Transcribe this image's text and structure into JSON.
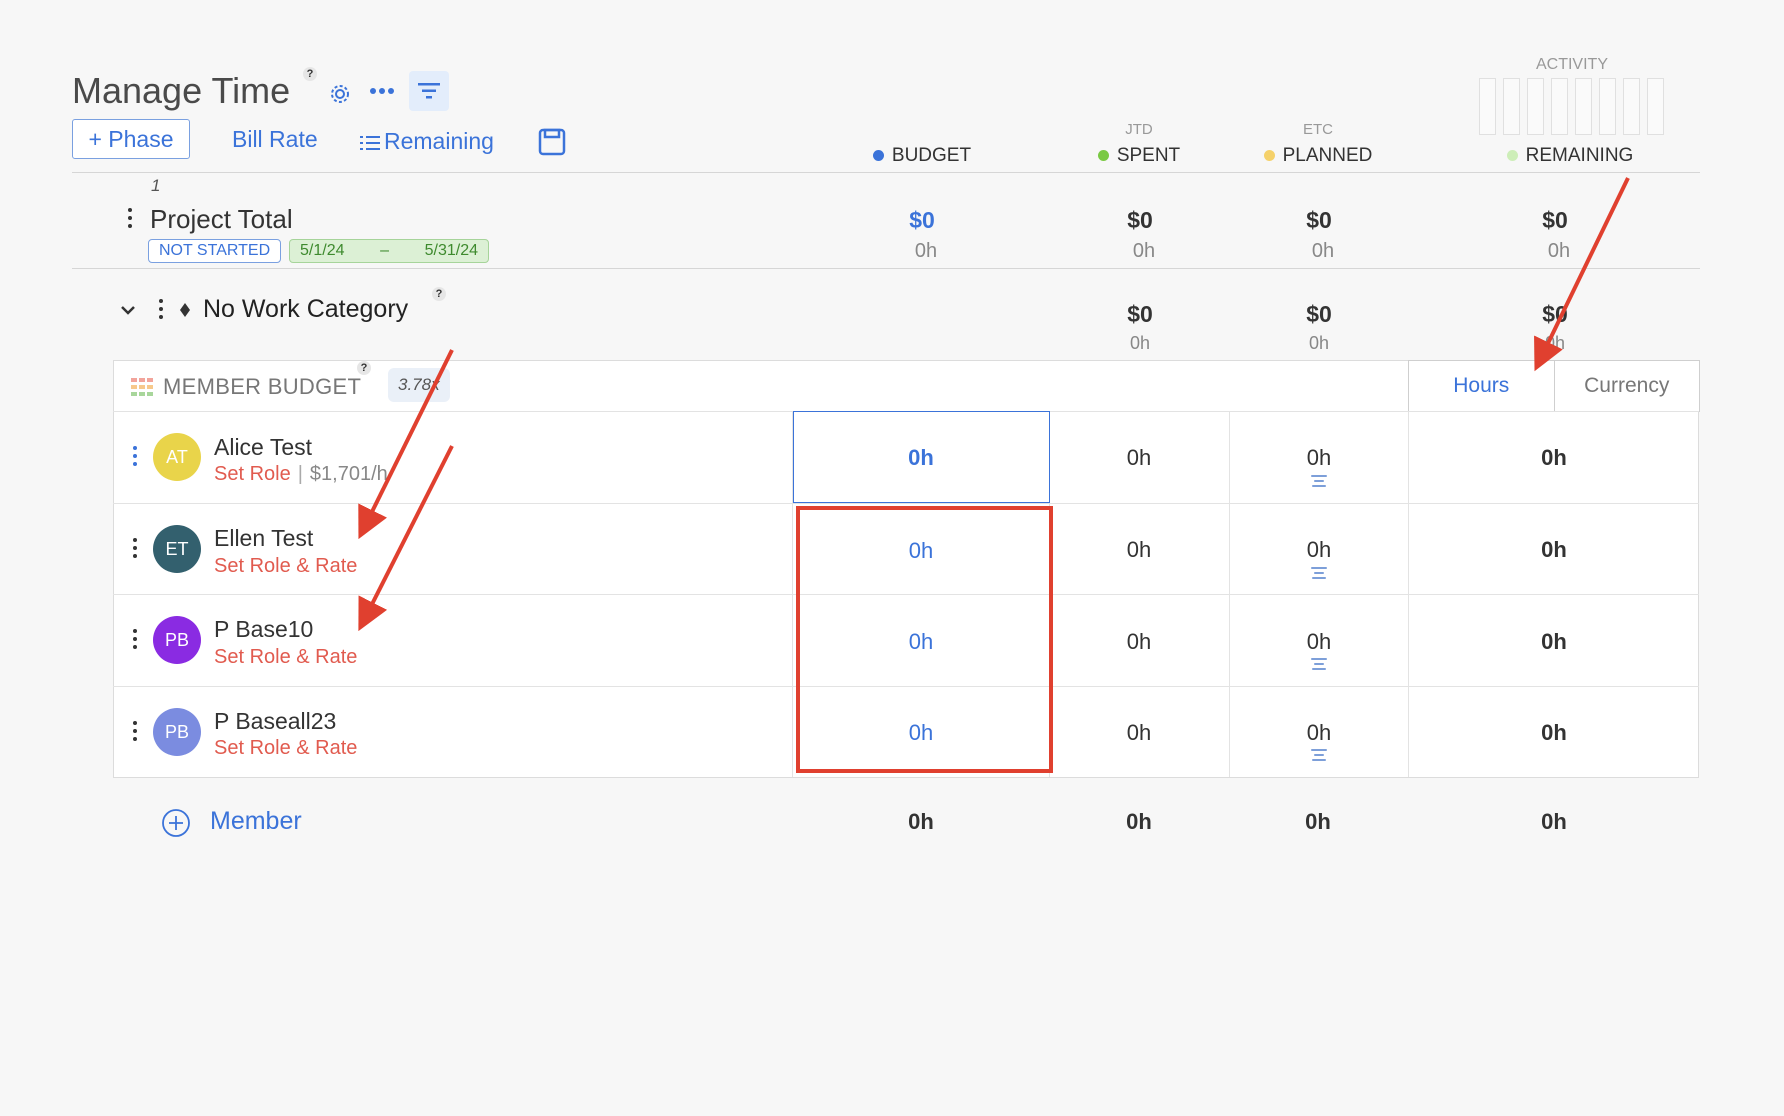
{
  "header": {
    "title": "Manage Time",
    "help": "?",
    "settings_icon": "gear-icon",
    "more_icon": "ellipsis-icon",
    "filter_icon": "filter-icon"
  },
  "toolbar": {
    "phase_button": "+ Phase",
    "bill_rate": "Bill Rate",
    "remaining": "Remaining",
    "save_icon": "save-icon"
  },
  "activity": {
    "label": "ACTIVITY"
  },
  "columns": {
    "budget": {
      "label": "BUDGET",
      "color": "#3b73d9"
    },
    "spent": {
      "sub": "JTD",
      "label": "SPENT",
      "color": "#7ac943"
    },
    "planned": {
      "sub": "ETC",
      "label": "PLANNED",
      "color": "#f5d16a"
    },
    "remaining": {
      "label": "REMAINING",
      "color": "#cdeeb8"
    }
  },
  "project_total": {
    "index": "1",
    "name": "Project Total",
    "status": "NOT STARTED",
    "date_start": "5/1/24",
    "date_sep": "–",
    "date_end": "5/31/24",
    "budget": {
      "money": "$0",
      "hours": "0h"
    },
    "spent": {
      "money": "$0",
      "hours": "0h"
    },
    "planned": {
      "money": "$0",
      "hours": "0h"
    },
    "remaining": {
      "money": "$0",
      "hours": "0h"
    }
  },
  "category": {
    "name": "No Work Category",
    "help": "?",
    "spent": {
      "money": "$0",
      "hours": "0h"
    },
    "planned": {
      "money": "$0",
      "hours": "0h"
    },
    "remaining": {
      "money": "$0",
      "hours": "0h"
    }
  },
  "member_budget": {
    "label": "MEMBER BUDGET",
    "help": "?",
    "multiplier": "3.78x",
    "toggle": {
      "hours": "Hours",
      "currency": "Currency",
      "active": "Hours"
    }
  },
  "members": [
    {
      "initials": "AT",
      "color": "#e9d44a",
      "name": "Alice Test",
      "role": "Set Role",
      "rate": "$1,701/h",
      "budget": "0h",
      "spent": "0h",
      "planned": "0h",
      "remaining": "0h"
    },
    {
      "initials": "ET",
      "color": "#33606e",
      "name": "Ellen Test",
      "role": "Set Role & Rate",
      "budget": "0h",
      "spent": "0h",
      "planned": "0h",
      "remaining": "0h"
    },
    {
      "initials": "PB",
      "color": "#8a2be2",
      "name": "P Base10",
      "role": "Set Role & Rate",
      "budget": "0h",
      "spent": "0h",
      "planned": "0h",
      "remaining": "0h"
    },
    {
      "initials": "PB",
      "color": "#7b8ce0",
      "name": "P Baseall23",
      "role": "Set Role & Rate",
      "budget": "0h",
      "spent": "0h",
      "planned": "0h",
      "remaining": "0h"
    }
  ],
  "footer": {
    "add_member": "Member",
    "budget": "0h",
    "spent": "0h",
    "planned": "0h",
    "remaining": "0h"
  },
  "annotation_color": "#e0402f"
}
